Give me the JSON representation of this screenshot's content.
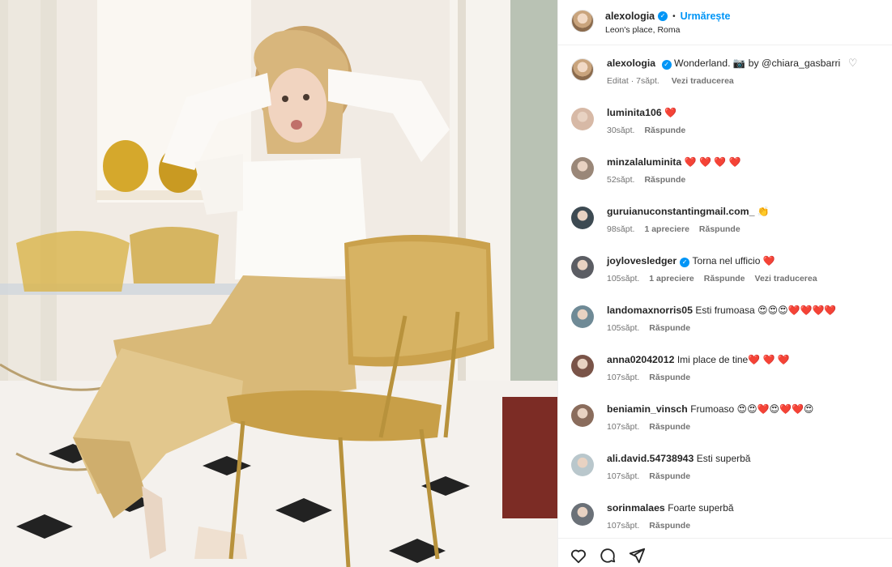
{
  "post": {
    "author": "alexologia",
    "follow_label": "Urmărește",
    "separator": "•",
    "location": "Leon's place, Roma"
  },
  "caption": {
    "author": "alexologia",
    "text": "Wonderland. 📷 by @chiara_gasbarri",
    "edited": "Editat · 7săpt.",
    "translate": "Vezi traducerea"
  },
  "comments": [
    {
      "author": "luminita106",
      "text": "❤️",
      "time": "30săpt.",
      "likes": "",
      "reply": "Răspunde",
      "translate": "",
      "verified": false
    },
    {
      "author": "minzalaluminita",
      "text": "❤️ ❤️ ❤️ ❤️",
      "time": "52săpt.",
      "likes": "",
      "reply": "Răspunde",
      "translate": "",
      "verified": false
    },
    {
      "author": "guruianuconstantingmail.com_",
      "text": "👏",
      "time": "98săpt.",
      "likes": "1 apreciere",
      "reply": "Răspunde",
      "translate": "",
      "verified": false
    },
    {
      "author": "joylovesledger",
      "text": "Torna nel ufficio ❤️",
      "time": "105săpt.",
      "likes": "1 apreciere",
      "reply": "Răspunde",
      "translate": "Vezi traducerea",
      "verified": true
    },
    {
      "author": "landomaxnorris05",
      "text": "Esti frumoasa 😍😍😍❤️❤️❤️❤️",
      "time": "105săpt.",
      "likes": "",
      "reply": "Răspunde",
      "translate": "",
      "verified": false
    },
    {
      "author": "anna02042012",
      "text": "Imi place de tine❤️ ❤️ ❤️",
      "time": "107săpt.",
      "likes": "",
      "reply": "Răspunde",
      "translate": "",
      "verified": false
    },
    {
      "author": "beniamin_vinsch",
      "text": "Frumoaso 😍😍❤️😍❤️❤️😍",
      "time": "107săpt.",
      "likes": "",
      "reply": "Răspunde",
      "translate": "",
      "verified": false
    },
    {
      "author": "ali.david.54738943",
      "text": "Esti superbă",
      "time": "107săpt.",
      "likes": "",
      "reply": "Răspunde",
      "translate": "",
      "verified": false
    },
    {
      "author": "sorinmalaes",
      "text": "Foarte superbă",
      "time": "107săpt.",
      "likes": "",
      "reply": "Răspunde",
      "translate": "",
      "verified": false
    }
  ],
  "icons": {
    "verified": "verified-badge-icon",
    "like": "heart-icon",
    "comment": "comment-icon",
    "share": "share-icon"
  },
  "colors": {
    "accent": "#0095f6",
    "text": "#262626",
    "muted": "#737373",
    "heart": "#ed4956"
  }
}
